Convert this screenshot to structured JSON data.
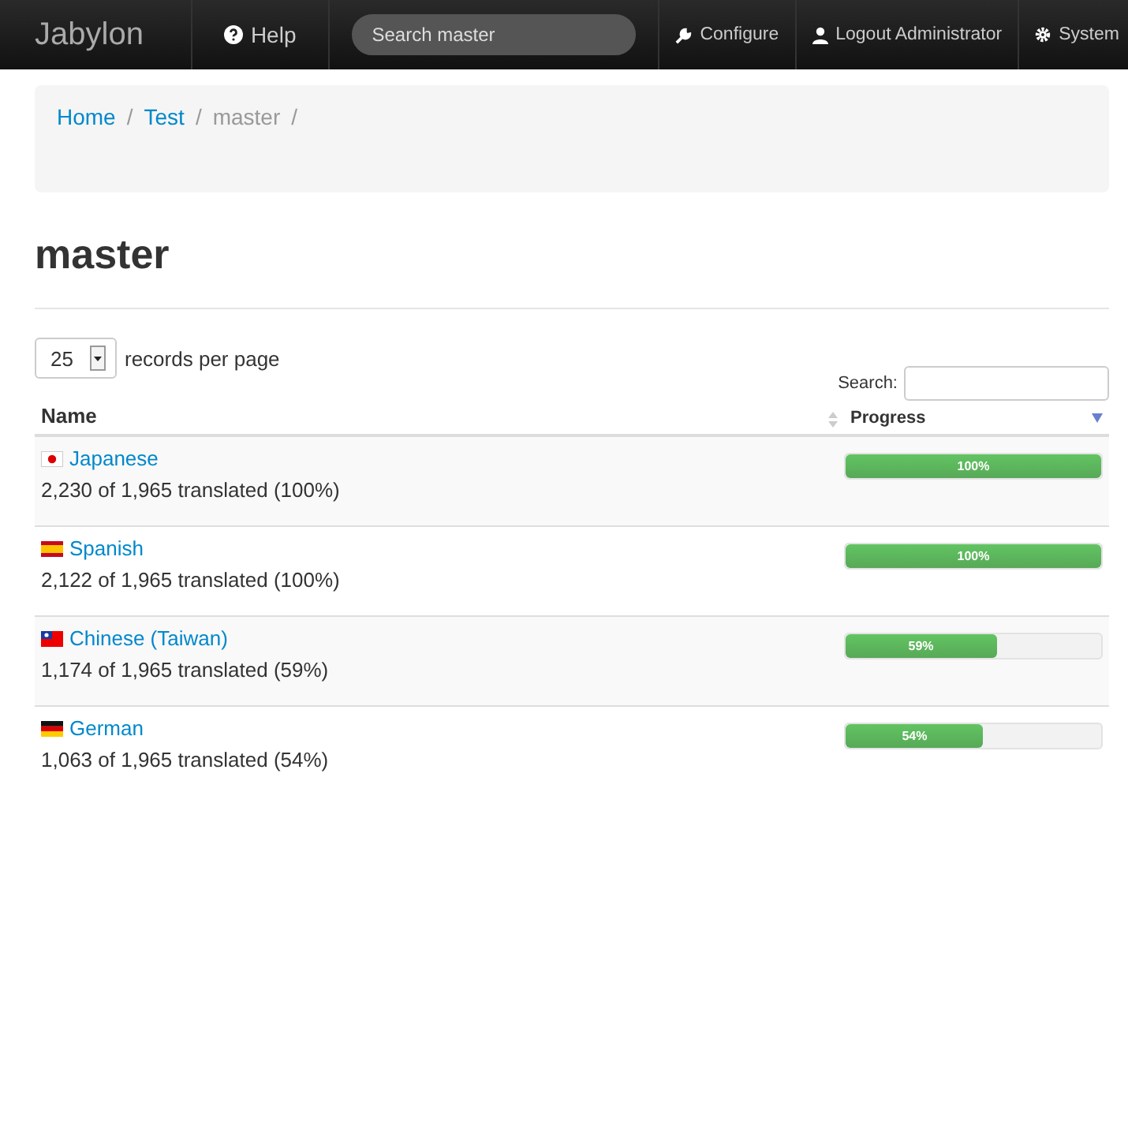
{
  "navbar": {
    "brand": "Jabylon",
    "help": "Help",
    "search": {
      "placeholder": "Search master"
    },
    "right_items": [
      {
        "kind": "wrench",
        "label": "Configure"
      },
      {
        "kind": "user",
        "label": "Logout Administrator"
      },
      {
        "kind": "gear",
        "label": "System"
      }
    ]
  },
  "breadcrumb": [
    {
      "label": "Home",
      "link": true,
      "separator": "/"
    },
    {
      "label": "Test",
      "link": true,
      "separator": "/"
    },
    {
      "label": "master",
      "link": false,
      "separator": "/"
    }
  ],
  "title": "master",
  "page_size": {
    "value": "25",
    "label": "records per page"
  },
  "search": {
    "label": "Search:"
  },
  "table": {
    "columns": [
      "Name",
      "Progress"
    ],
    "rows": [
      {
        "kind": "jp",
        "name": "Japanese",
        "summary": "2,230 of 1,965 translated (100%)",
        "level": 1,
        "reading": "100%"
      },
      {
        "kind": "es",
        "name": "Spanish",
        "summary": "2,122 of 1,965 translated (100%)",
        "level": 1,
        "reading": "100%"
      },
      {
        "kind": "tw",
        "name": "Chinese (Taiwan)",
        "summary": "1,174 of 1,965 translated (59%)",
        "level": 0.59,
        "reading": "59%"
      },
      {
        "kind": "de",
        "name": "German",
        "summary": "1,063 of 1,965 translated (54%)",
        "level": 0.54,
        "reading": "54%"
      }
    ]
  }
}
